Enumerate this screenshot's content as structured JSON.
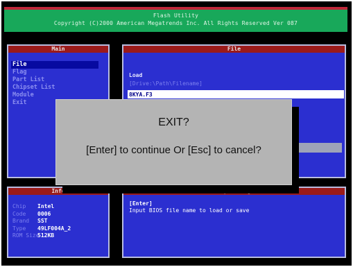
{
  "title_bar": {
    "app_title": "Flash Utility",
    "copyright": "Copyright (C)2000 American Megatrends Inc. All Rights Reserved Ver 087"
  },
  "main_panel": {
    "header": "Main",
    "items": [
      {
        "label": "File",
        "selected": true
      },
      {
        "label": "Flag",
        "selected": false
      },
      {
        "label": "Part List",
        "selected": false
      },
      {
        "label": "Chipset List",
        "selected": false
      },
      {
        "label": "Module",
        "selected": false
      },
      {
        "label": "Exit",
        "selected": false
      }
    ]
  },
  "file_panel": {
    "header": "File",
    "load_label": "Load",
    "path_hint": "[Drive:\\Path\\Filename]",
    "filename_value": "8KYA.F3"
  },
  "info_panel": {
    "header": "Info",
    "rows": [
      {
        "key": "Chip",
        "value": "Intel"
      },
      {
        "key": "Code",
        "value": "0006"
      },
      {
        "key": "Brand",
        "value": "SST"
      },
      {
        "key": "Type",
        "value": "49LF004A_2"
      },
      {
        "key": "ROM Size",
        "value": "512KB"
      }
    ]
  },
  "help_panel": {
    "header": "Help/Message",
    "key": "[Enter]",
    "message": "Input BIOS file name to load or save"
  },
  "exit_dialog": {
    "title": "EXIT?",
    "message": "[Enter] to continue Or [Esc] to cancel?"
  },
  "colors": {
    "panel_blue": "#2b2fd0",
    "header_red": "#9b1a1a",
    "title_green": "#18a85a",
    "dialog_gray": "#b4b4b4"
  }
}
